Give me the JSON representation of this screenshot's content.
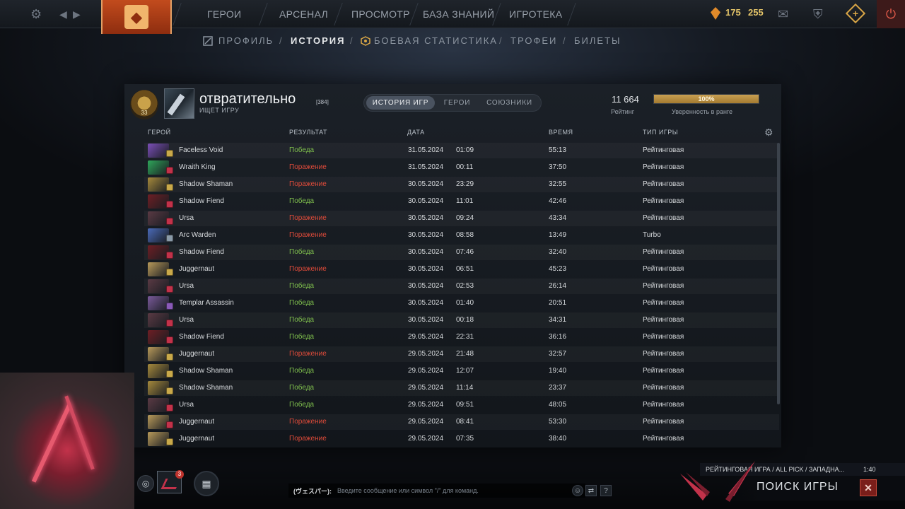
{
  "topbar": {
    "nav": [
      "ГЕРОИ",
      "АРСЕНАЛ",
      "ПРОСМОТР",
      "БАЗА ЗНАНИЙ",
      "ИГРОТЕКА"
    ],
    "currency_1": "175",
    "currency_2": "255"
  },
  "subnav": {
    "items": [
      "ПРОФИЛЬ",
      "ИСТОРИЯ",
      "БОЕВАЯ СТАТИСТИКА",
      "ТРОФЕИ",
      "БИЛЕТЫ"
    ],
    "separator": "/"
  },
  "profile": {
    "name": "отвратительно",
    "level": "[384]",
    "status": "ИЩЕТ ИГРУ",
    "rating_value": "11 664",
    "rating_label": "Рейтинг",
    "confidence_text": "100%",
    "confidence_fraction": 1.0,
    "confidence_label": "Уверенность в ранге",
    "rank_number": "33"
  },
  "tabs": [
    "ИСТОРИЯ ИГР",
    "ГЕРОИ",
    "СОЮЗНИКИ"
  ],
  "columns": [
    "ГЕРОЙ",
    "РЕЗУЛЬТАТ",
    "ДАТА",
    "ВРЕМЯ",
    "ТИП ИГРЫ"
  ],
  "matches": [
    {
      "hero": "Faceless Void",
      "result": "Победа",
      "date": "31.05.2024",
      "time": "01:09",
      "duration": "55:13",
      "type": "Рейтинговая",
      "win": true,
      "color": "#7b4fb8",
      "badge": "#c9a94a"
    },
    {
      "hero": "Wraith King",
      "result": "Поражение",
      "date": "31.05.2024",
      "time": "00:11",
      "duration": "37:50",
      "type": "Рейтинговая",
      "win": false,
      "color": "#2fa65a",
      "badge": "#c2324a"
    },
    {
      "hero": "Shadow Shaman",
      "result": "Поражение",
      "date": "30.05.2024",
      "time": "23:29",
      "duration": "32:55",
      "type": "Рейтинговая",
      "win": false,
      "color": "#a68a3c",
      "badge": "#c9a94a"
    },
    {
      "hero": "Shadow Fiend",
      "result": "Победа",
      "date": "30.05.2024",
      "time": "11:01",
      "duration": "42:46",
      "type": "Рейтинговая",
      "win": true,
      "color": "#6e1e24",
      "badge": "#c2324a"
    },
    {
      "hero": "Ursa",
      "result": "Поражение",
      "date": "30.05.2024",
      "time": "09:24",
      "duration": "43:34",
      "type": "Рейтинговая",
      "win": false,
      "color": "#5a3a44",
      "badge": "#c2324a"
    },
    {
      "hero": "Arc Warden",
      "result": "Поражение",
      "date": "30.05.2024",
      "time": "08:58",
      "duration": "13:49",
      "type": "Turbo",
      "win": false,
      "color": "#4a6ab8",
      "badge": "#8a9aa8"
    },
    {
      "hero": "Shadow Fiend",
      "result": "Победа",
      "date": "30.05.2024",
      "time": "07:46",
      "duration": "32:40",
      "type": "Рейтинговая",
      "win": true,
      "color": "#6e1e24",
      "badge": "#c2324a"
    },
    {
      "hero": "Juggernaut",
      "result": "Поражение",
      "date": "30.05.2024",
      "time": "06:51",
      "duration": "45:23",
      "type": "Рейтинговая",
      "win": false,
      "color": "#b89a5a",
      "badge": "#c9a94a"
    },
    {
      "hero": "Ursa",
      "result": "Победа",
      "date": "30.05.2024",
      "time": "02:53",
      "duration": "26:14",
      "type": "Рейтинговая",
      "win": true,
      "color": "#5a3a44",
      "badge": "#c2324a"
    },
    {
      "hero": "Templar Assassin",
      "result": "Победа",
      "date": "30.05.2024",
      "time": "01:40",
      "duration": "20:51",
      "type": "Рейтинговая",
      "win": true,
      "color": "#7a5a9a",
      "badge": "#8a5ab8"
    },
    {
      "hero": "Ursa",
      "result": "Победа",
      "date": "30.05.2024",
      "time": "00:18",
      "duration": "34:31",
      "type": "Рейтинговая",
      "win": true,
      "color": "#5a3a44",
      "badge": "#c2324a"
    },
    {
      "hero": "Shadow Fiend",
      "result": "Победа",
      "date": "29.05.2024",
      "time": "22:31",
      "duration": "36:16",
      "type": "Рейтинговая",
      "win": true,
      "color": "#6e1e24",
      "badge": "#c2324a"
    },
    {
      "hero": "Juggernaut",
      "result": "Поражение",
      "date": "29.05.2024",
      "time": "21:48",
      "duration": "32:57",
      "type": "Рейтинговая",
      "win": false,
      "color": "#b89a5a",
      "badge": "#c9a94a"
    },
    {
      "hero": "Shadow Shaman",
      "result": "Победа",
      "date": "29.05.2024",
      "time": "12:07",
      "duration": "19:40",
      "type": "Рейтинговая",
      "win": true,
      "color": "#a68a3c",
      "badge": "#c9a94a"
    },
    {
      "hero": "Shadow Shaman",
      "result": "Победа",
      "date": "29.05.2024",
      "time": "11:14",
      "duration": "23:37",
      "type": "Рейтинговая",
      "win": true,
      "color": "#a68a3c",
      "badge": "#c9a94a"
    },
    {
      "hero": "Ursa",
      "result": "Победа",
      "date": "29.05.2024",
      "time": "09:51",
      "duration": "48:05",
      "type": "Рейтинговая",
      "win": true,
      "color": "#5a3a44",
      "badge": "#c2324a"
    },
    {
      "hero": "Juggernaut",
      "result": "Поражение",
      "date": "29.05.2024",
      "time": "08:41",
      "duration": "53:30",
      "type": "Рейтинговая",
      "win": false,
      "color": "#b89a5a",
      "badge": "#c2324a"
    },
    {
      "hero": "Juggernaut",
      "result": "Поражение",
      "date": "29.05.2024",
      "time": "07:35",
      "duration": "38:40",
      "type": "Рейтинговая",
      "win": false,
      "color": "#b89a5a",
      "badge": "#c9a94a"
    }
  ],
  "bottom": {
    "notification_count": "3",
    "chat_channel": "(ヴェスパー):",
    "chat_placeholder": "Введите сообщение или символ \"/\" для команд.",
    "help": "?"
  },
  "queue": {
    "mode": "РЕЙТИНГОВАЯ ИГРА / ALL PICK / ЗАПАДНА...",
    "elapsed": "1:40",
    "title": "ПОИСК ИГРЫ",
    "cancel": "✕"
  }
}
